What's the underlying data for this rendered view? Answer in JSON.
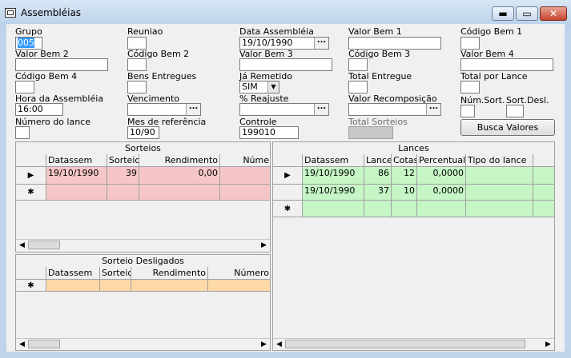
{
  "window": {
    "title": "Assembléias",
    "min": "▬",
    "max": "▭",
    "close": "✕"
  },
  "fields": {
    "grupo": {
      "label": "Grupo",
      "value": "005"
    },
    "reuniao": {
      "label": "Reuniao",
      "value": ""
    },
    "data_assembleia": {
      "label": "Data Assembléia",
      "value": "19/10/1990"
    },
    "valor_bem1": {
      "label": "Valor Bem 1",
      "value": ""
    },
    "codigo_bem1": {
      "label": "Código Bem 1",
      "value": ""
    },
    "valor_bem2": {
      "label": "Valor Bem 2",
      "value": ""
    },
    "codigo_bem2": {
      "label": "Código Bem 2",
      "value": ""
    },
    "valor_bem3": {
      "label": "Valor Bem 3",
      "value": ""
    },
    "codigo_bem3": {
      "label": "Código Bem 3",
      "value": ""
    },
    "valor_bem4": {
      "label": "Valor Bem 4",
      "value": ""
    },
    "codigo_bem4": {
      "label": "Código Bem 4",
      "value": ""
    },
    "bens_entregues": {
      "label": "Bens Entregues",
      "value": ""
    },
    "ja_remetido": {
      "label": "Já Remetido",
      "value": "SIM"
    },
    "total_entregue": {
      "label": "Total Entregue",
      "value": ""
    },
    "total_por_lance": {
      "label": "Total por Lance",
      "value": ""
    },
    "hora_assembleia": {
      "label": "Hora da Assembléia",
      "value": "16:00"
    },
    "vencimento": {
      "label": "Vencimento",
      "value": ""
    },
    "pct_reajuste": {
      "label": "% Reajuste",
      "value": ""
    },
    "valor_recomposicao": {
      "label": "Valor Recomposição",
      "value": ""
    },
    "num_sort": {
      "label": "Núm.Sort.",
      "value": ""
    },
    "sort_desl": {
      "label": "Sort.Desl.",
      "value": ""
    },
    "numero_lance": {
      "label": "Número do lance",
      "value": ""
    },
    "mes_referencia": {
      "label": "Mes de referência",
      "value": "10/90"
    },
    "controle": {
      "label": "Controle",
      "value": "199010"
    },
    "total_sorteios": {
      "label": "Total Sorteios",
      "value": ""
    }
  },
  "buttons": {
    "busca_valores": "Busca Valores",
    "ellipsis": "...",
    "dropdown": "▼"
  },
  "sorteios": {
    "title": "Sorteios",
    "columns": [
      "Datassem",
      "Sorteio",
      "Rendimento",
      "Núme"
    ],
    "rows": [
      [
        "19/10/1990",
        "39",
        "0,00",
        ""
      ]
    ]
  },
  "lances": {
    "title": "Lances",
    "columns": [
      "Datassem",
      "Lance",
      "Cotas",
      "Percentual",
      "Tipo do lance"
    ],
    "rows": [
      [
        "19/10/1990",
        "86",
        "12",
        "0,0000",
        ""
      ],
      [
        "19/10/1990",
        "37",
        "10",
        "0,0000",
        ""
      ]
    ]
  },
  "sorteio_desligados": {
    "title": "Sorteio Desligados",
    "columns": [
      "Datassem",
      "Sorteio",
      "Rendimento",
      "Número"
    ]
  },
  "markers": {
    "current": "▶",
    "new": "✱",
    "left": "◀",
    "right": "▶"
  }
}
